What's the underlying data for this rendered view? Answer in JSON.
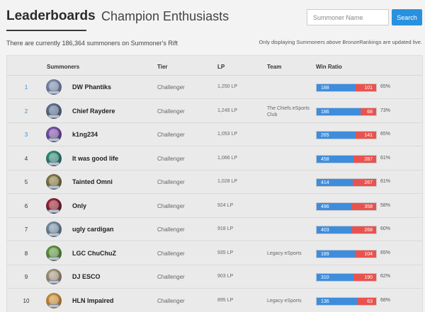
{
  "tabs": {
    "active": "Leaderboards",
    "other": "Champion Enthusiasts"
  },
  "search": {
    "placeholder": "Summoner Name",
    "button": "Search"
  },
  "info": {
    "summoner_count": "There are currently 186,364 summoners on Summoner's Rift",
    "note": "Only displaying Summoners above BronzeRankings are updated live."
  },
  "columns": {
    "summoners": "Summoners",
    "tier": "Tier",
    "lp": "LP",
    "team": "Team",
    "win_ratio": "Win Ratio"
  },
  "colors": {
    "wins": "#3e8ddd",
    "losses": "#e9534f",
    "accent": "#2a91de"
  },
  "rows": [
    {
      "rank": "1",
      "name": "DW Phantiks",
      "tier": "Challenger",
      "lp": "1,250 LP",
      "team": "",
      "wins": "188",
      "losses": "101",
      "pct": "65%",
      "avatar": [
        "#8a99b4",
        "#3f4f6e"
      ]
    },
    {
      "rank": "2",
      "name": "Chief Raydere",
      "tier": "Challenger",
      "lp": "1,249 LP",
      "team": "The Chiefs eSports Club",
      "wins": "186",
      "losses": "68",
      "pct": "73%",
      "avatar": [
        "#6b7f9a",
        "#2c3b55"
      ]
    },
    {
      "rank": "3",
      "name": "k1ng234",
      "tier": "Challenger",
      "lp": "1,053 LP",
      "team": "",
      "wins": "265",
      "losses": "141",
      "pct": "65%",
      "avatar": [
        "#8c5fb7",
        "#3a2160"
      ]
    },
    {
      "rank": "4",
      "name": "It was good life",
      "tier": "Challenger",
      "lp": "1,066 LP",
      "team": "",
      "wins": "458",
      "losses": "287",
      "pct": "61%",
      "avatar": [
        "#3ba07f",
        "#123d4a"
      ]
    },
    {
      "rank": "5",
      "name": "Tainted Omni",
      "tier": "Challenger",
      "lp": "1,028 LP",
      "team": "",
      "wins": "414",
      "losses": "267",
      "pct": "61%",
      "avatar": [
        "#9a8a4c",
        "#3b3a26"
      ]
    },
    {
      "rank": "6",
      "name": "Only",
      "tier": "Challenger",
      "lp": "924 LP",
      "team": "",
      "wins": "496",
      "losses": "358",
      "pct": "58%",
      "avatar": [
        "#b5303e",
        "#2a0d1a"
      ]
    },
    {
      "rank": "7",
      "name": "ugly cardigan",
      "tier": "Challenger",
      "lp": "918 LP",
      "team": "",
      "wins": "403",
      "losses": "268",
      "pct": "60%",
      "avatar": [
        "#8aa3b8",
        "#2d3e4e"
      ]
    },
    {
      "rank": "8",
      "name": "LGC ChuChuZ",
      "tier": "Challenger",
      "lp": "935 LP",
      "team": "Legacy eSports",
      "wins": "189",
      "losses": "104",
      "pct": "65%",
      "avatar": [
        "#6fa84a",
        "#2b4a22"
      ]
    },
    {
      "rank": "9",
      "name": "DJ ESCO",
      "tier": "Challenger",
      "lp": "903 LP",
      "team": "",
      "wins": "310",
      "losses": "190",
      "pct": "62%",
      "avatar": [
        "#b7a98f",
        "#5a4b3a"
      ]
    },
    {
      "rank": "10",
      "name": "HLN Impaired",
      "tier": "Challenger",
      "lp": "895 LP",
      "team": "Legacy eSports",
      "wins": "136",
      "losses": "63",
      "pct": "68%",
      "avatar": [
        "#d9a043",
        "#7a4a1f"
      ]
    }
  ]
}
